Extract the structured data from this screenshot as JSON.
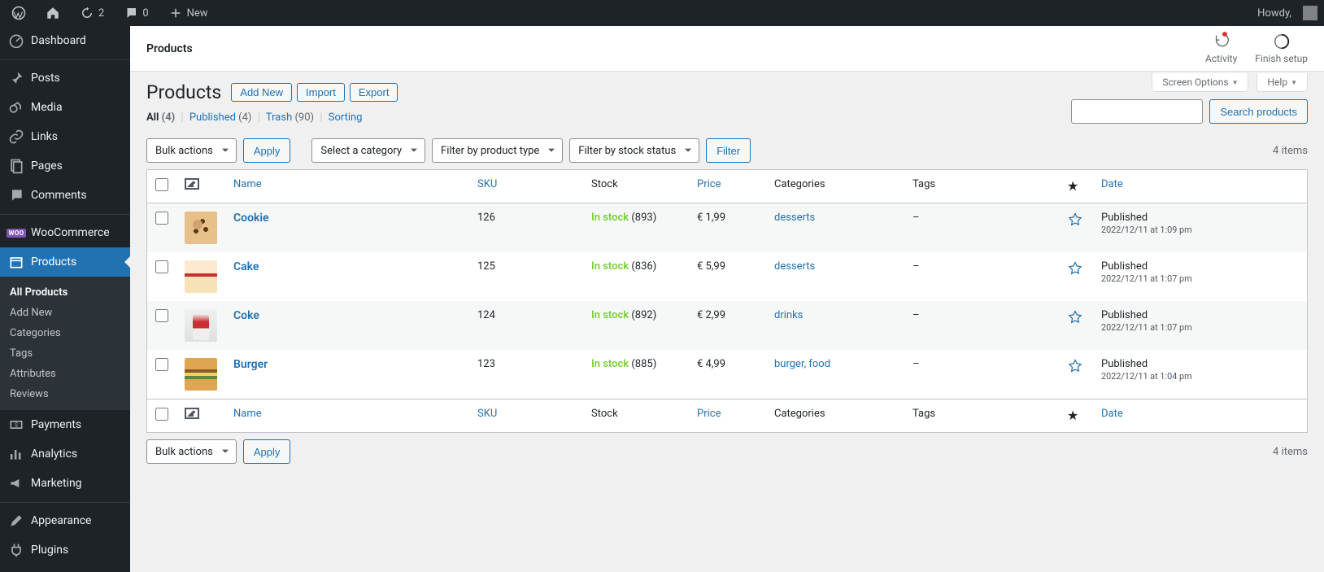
{
  "adminbar": {
    "updates": "2",
    "comments": "0",
    "new": "New",
    "howdy": "Howdy,"
  },
  "sidemenu": {
    "dashboard": "Dashboard",
    "posts": "Posts",
    "media": "Media",
    "links": "Links",
    "pages": "Pages",
    "comments": "Comments",
    "woocommerce": "WooCommerce",
    "products": "Products",
    "payments": "Payments",
    "analytics": "Analytics",
    "marketing": "Marketing",
    "appearance": "Appearance",
    "plugins": "Plugins",
    "sub": {
      "all": "All Products",
      "addnew": "Add New",
      "categories": "Categories",
      "tags": "Tags",
      "attributes": "Attributes",
      "reviews": "Reviews"
    },
    "woobadge": "WOO"
  },
  "topbar": {
    "title": "Products",
    "activity": "Activity",
    "finish": "Finish setup"
  },
  "screen_meta": {
    "screen_options": "Screen Options",
    "help": "Help"
  },
  "heading": {
    "title": "Products",
    "add_new": "Add New",
    "import": "Import",
    "export": "Export"
  },
  "subsubsub": {
    "all": "All",
    "all_count": "(4)",
    "published": "Published",
    "published_count": "(4)",
    "trash": "Trash",
    "trash_count": "(90)",
    "sorting": "Sorting"
  },
  "search": {
    "button": "Search products"
  },
  "tablenav": {
    "bulk": "Bulk actions",
    "apply": "Apply",
    "select_cat": "Select a category",
    "filter_type": "Filter by product type",
    "filter_stock": "Filter by stock status",
    "filter": "Filter",
    "items_count": "4 items"
  },
  "table": {
    "headers": {
      "name": "Name",
      "sku": "SKU",
      "stock": "Stock",
      "price": "Price",
      "categories": "Categories",
      "tags": "Tags",
      "date": "Date"
    },
    "rows": [
      {
        "name": "Cookie",
        "sku": "126",
        "stock_label": "In stock",
        "stock_qty": "(893)",
        "price": "€ 1,99",
        "categories": "desserts",
        "tags": "–",
        "published": "Published",
        "date": "2022/12/11 at 1:09 pm",
        "thumb": "img-cookie"
      },
      {
        "name": "Cake",
        "sku": "125",
        "stock_label": "In stock",
        "stock_qty": "(836)",
        "price": "€ 5,99",
        "categories": "desserts",
        "tags": "–",
        "published": "Published",
        "date": "2022/12/11 at 1:07 pm",
        "thumb": "img-cake"
      },
      {
        "name": "Coke",
        "sku": "124",
        "stock_label": "In stock",
        "stock_qty": "(892)",
        "price": "€ 2,99",
        "categories": "drinks",
        "tags": "–",
        "published": "Published",
        "date": "2022/12/11 at 1:07 pm",
        "thumb": "img-coke"
      },
      {
        "name": "Burger",
        "sku": "123",
        "stock_label": "In stock",
        "stock_qty": "(885)",
        "price": "€ 4,99",
        "categories": "burger, food",
        "tags": "–",
        "published": "Published",
        "date": "2022/12/11 at 1:04 pm",
        "thumb": "img-burger"
      }
    ]
  }
}
